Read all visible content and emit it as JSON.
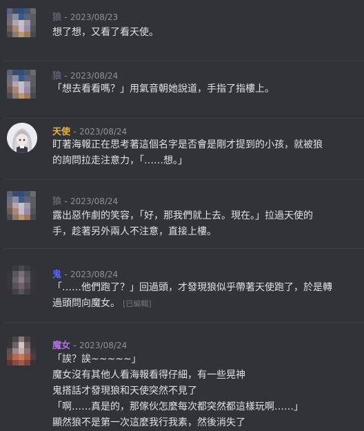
{
  "colors": {
    "name_wolf": "#5b6378",
    "name_angel": "#f0b232",
    "name_ghost": "#5865f2",
    "name_witch": "#b46ee8",
    "timestamp": "#8e9297",
    "background": "#323338"
  },
  "messages": [
    {
      "author": "狼",
      "sep": " - ",
      "timestamp": "2023/08/23",
      "lines": [
        "想了想，又看了看天使。"
      ]
    },
    {
      "author": "狼",
      "sep": " - ",
      "timestamp": "2023/08/24",
      "lines": [
        "「想去看看嗎？」用氣音朝她說道，手指了指樓上。"
      ]
    },
    {
      "author": "天使",
      "sep": " - ",
      "timestamp": "2023/08/24",
      "lines": [
        "盯著海報正在思考著這個名字是否會是剛才提到的小孩，就被狼",
        "的詢問拉走注意力，「……想。」"
      ]
    },
    {
      "author": "狼",
      "sep": " - ",
      "timestamp": "2023/08/24",
      "lines": [
        "露出惡作劇的笑容，「好，那我們就上去。現在。」拉過天使的",
        "手，趁著另外兩人不注意，直接上樓。"
      ]
    },
    {
      "author": "鬼",
      "sep": " - ",
      "timestamp": "2023/08/24",
      "lines": [
        "「……他們跑了？」回過頭，才發現狼似乎帶著天使跑了，於是轉",
        "過頭問向魔女。"
      ],
      "edited": "[已編輯]"
    },
    {
      "author": "魔女",
      "sep": " - ",
      "timestamp": "2023/08/24",
      "lines": [
        "「誒？誒~~~~~」",
        "魔女沒有其他人看海報看得仔細，有一些晃神",
        "鬼搭話才發現狼和天使突然不見了",
        "「啊……真是的，那傢伙怎麼每次都突然都這樣玩啊……」",
        "顯然狼不是第一次這麼我行我素，然後消失了"
      ]
    }
  ]
}
